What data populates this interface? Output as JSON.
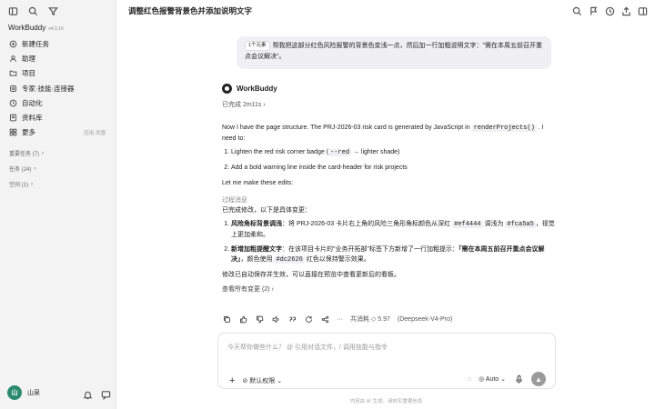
{
  "sidebar": {
    "brand": "WorkBuddy",
    "version": "v4.3.10",
    "items": [
      {
        "label": "新建任务",
        "icon": "new-task-icon"
      },
      {
        "label": "助理",
        "icon": "assistant-icon"
      },
      {
        "label": "项目",
        "icon": "folder-icon"
      },
      {
        "label": "专家·技能·连接器",
        "icon": "expert-icon"
      },
      {
        "label": "自动化",
        "icon": "clock-icon"
      },
      {
        "label": "资料库",
        "icon": "library-icon"
      },
      {
        "label": "更多",
        "icon": "more-icon",
        "right": "应用·灵感"
      }
    ],
    "groups": [
      {
        "label": "重要任务 (7)"
      },
      {
        "label": "任务 (24)"
      },
      {
        "label": "空间 (1)"
      }
    ],
    "user": {
      "name": "山泉",
      "initial": "山"
    }
  },
  "header": {
    "title": "调整红色报警背景色并添加说明文字"
  },
  "user_message": {
    "chip": "1个元素",
    "text": "帮我把这部分红色风险报警的背景色变浅一点，然后加一行加粗说明文字：\"需在本周五前召开重点会议解决\"。"
  },
  "agent": {
    "name": "WorkBuddy",
    "done": "已完成 2m11s",
    "p1a": "Now I have the page structure. The PRJ-2026-03 risk card is generated by JavaScript in",
    "p1code": "renderProjects()",
    "p1b": ". I need to:",
    "li1a": "Lighten the red risk corner badge (",
    "li1code": "--red",
    "li1b": "→ lighter shade)",
    "li2": "Add a bold warning line inside the card-header for risk projects",
    "p2": "Let me make these edits:",
    "process": "过程消息",
    "summary": "已完成修改，以下是具体变更：",
    "c1title": "风险角标背景调浅",
    "c1a": "：将 PRJ-2026-03 卡片右上角的风险三角形角标颜色从深红",
    "c1code1": "#ef4444",
    "c1b": "调浅为",
    "c1code2": "#fca5a5",
    "c1c": "，视觉上更加柔和。",
    "c2title": "新增加粗提醒文字",
    "c2a": "：在该项目卡片的\"业务开拓部\"标签下方新增了一行加粗提示：",
    "c2bold": "「需在本周五前召开重点会议解决」",
    "c2b": "，颜色使用",
    "c2code": "#dc2626",
    "c2c": "红色以保持警示效果。",
    "p3": "修改已自动保存并生效，可以直接在预览中查看更新后的看板。",
    "changes": "查看所有变更 (2)"
  },
  "actions": {
    "cost": "共消耗 ◇ 5.97",
    "model": "(Deepseek-V4-Pro)"
  },
  "input": {
    "placeholder": "今天帮你做些什么？ @ 引用对话文件，/ 调用技能与指令",
    "permission": "默认权限",
    "mode": "Auto"
  },
  "disclaimer": "内容由 AI 生成，请核实重要信息"
}
